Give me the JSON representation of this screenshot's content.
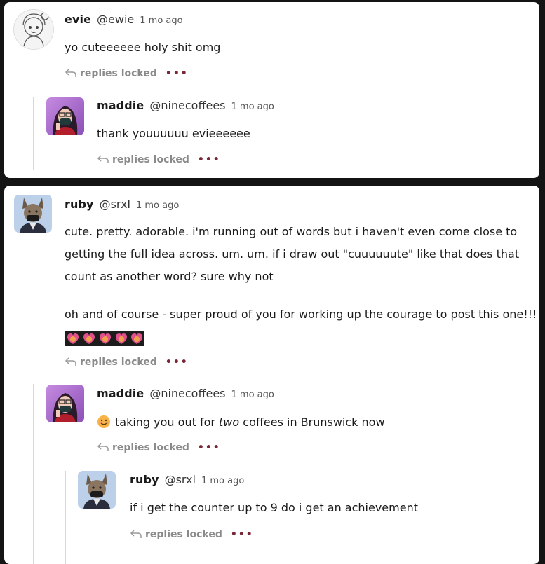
{
  "comments": [
    {
      "username": "evie",
      "handle": "@ewie",
      "time": "1 mo ago",
      "lines": [
        "yo cuteeeeee holy shit omg"
      ],
      "replies_label": "replies locked"
    },
    {
      "username": "maddie",
      "handle": "@ninecoffees",
      "time": "1 mo ago",
      "lines": [
        "thank youuuuuu evieeeeee"
      ],
      "replies_label": "replies locked"
    },
    {
      "username": "ruby",
      "handle": "@srxl",
      "time": "1 mo ago",
      "lines": [
        "cute. pretty. adorable. i'm running out of words but i haven't even come close to",
        "getting the full idea across. um. um. if i draw out \"cuuuuuute\" like that does that",
        "count as another word? sure why not",
        "oh and of course - super proud of you for working up the courage to post this one!!!"
      ],
      "replies_label": "replies locked"
    },
    {
      "username": "maddie",
      "handle": "@ninecoffees",
      "time": "1 mo ago",
      "text_before": "taking you out for ",
      "text_em": "two",
      "text_after": " coffees in Brunswick now",
      "replies_label": "replies locked"
    },
    {
      "username": "ruby",
      "handle": "@srxl",
      "time": "1 mo ago",
      "lines": [
        "if i get the counter up to 9 do i get an achievement"
      ],
      "replies_label": "replies locked"
    }
  ],
  "more_glyph": "•••",
  "colors": {
    "page_bg": "#141414",
    "card_bg": "#ffffff",
    "more_dots": "#7a2636",
    "muted": "#8a8a8a"
  },
  "icons": [
    "reply-arrow-icon",
    "more-dots-icon",
    "smiling-face-emoji",
    "heart-emoji-row"
  ]
}
